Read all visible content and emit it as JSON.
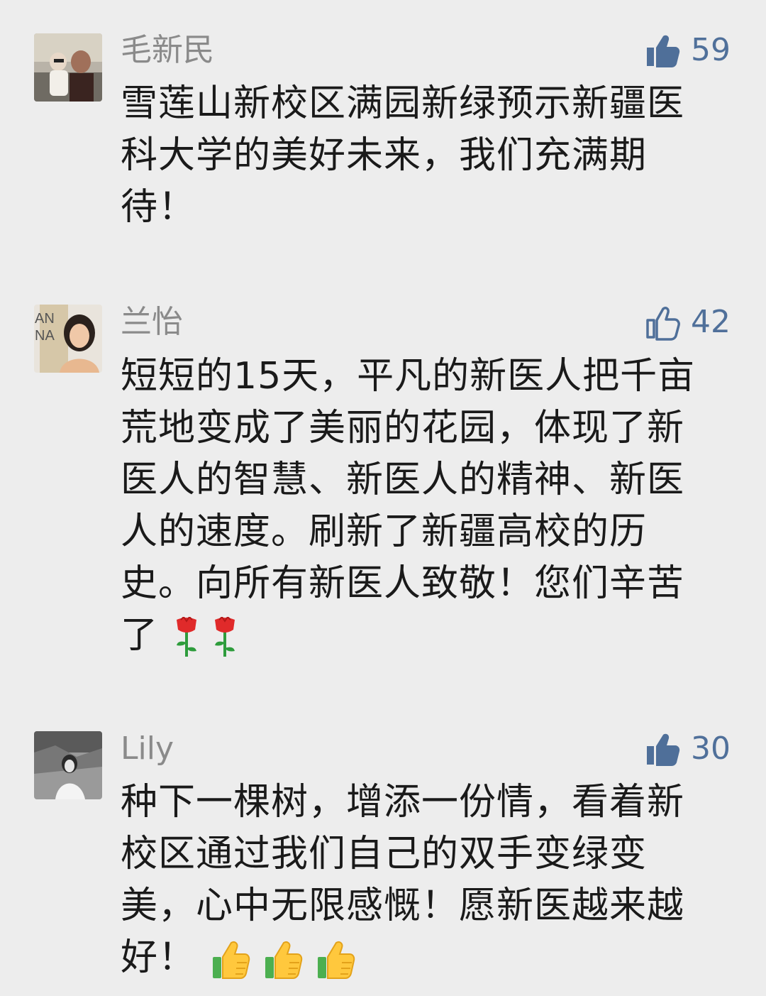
{
  "comments": [
    {
      "name": "毛新民",
      "likes": "59",
      "liked": true,
      "avatar_icon": "person-with-baby-avatar",
      "text": "雪莲山新校区满园新绿预示新疆医科大学的美好未来，我们充满期待！"
    },
    {
      "name": "兰怡",
      "likes": "42",
      "liked": false,
      "avatar_icon": "woman-portrait-avatar",
      "avatar_text": "AN NA",
      "text": "短短的15天，平凡的新医人把千亩荒地变成了美丽的花园，体现了新医人的智慧、新医人的精神、新医人的速度。刷新了新疆高校的历史。向所有新医人致敬！您们辛苦了",
      "emojis": [
        "rose-emoji",
        "rose-emoji"
      ]
    },
    {
      "name": "Lily",
      "likes": "30",
      "liked": true,
      "avatar_icon": "girl-bw-photo-avatar",
      "text": "种下一棵树，增添一份情，看着新校区通过我们自己的双手变绿变美，心中无限感慨！愿新医越来越好！",
      "emojis": [
        "thumbs-up-emoji",
        "thumbs-up-emoji",
        "thumbs-up-emoji"
      ]
    }
  ],
  "colors": {
    "background": "#ededed",
    "name": "#8a8a8a",
    "like_accent": "#50709a",
    "text": "#1a1a1a"
  }
}
